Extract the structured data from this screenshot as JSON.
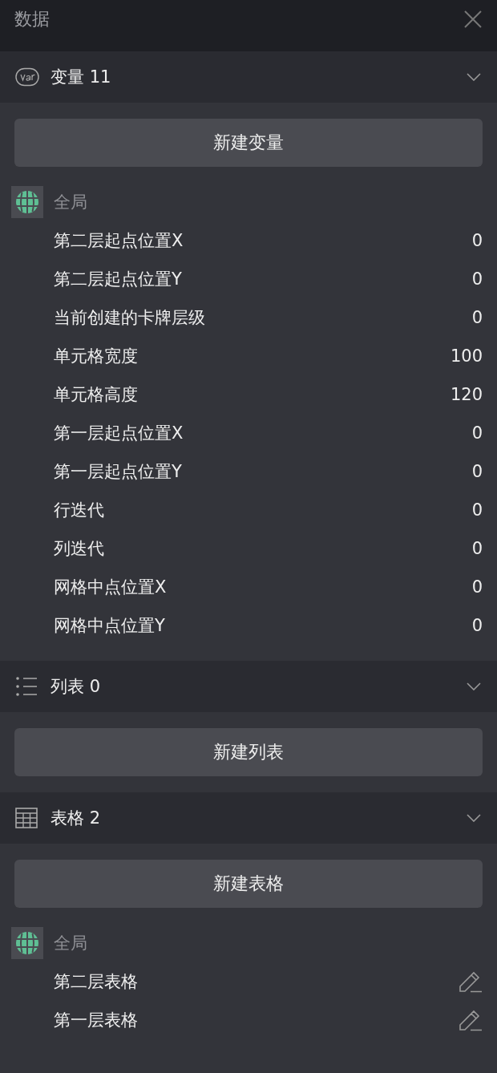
{
  "panel": {
    "title": "数据"
  },
  "sections": [
    {
      "kind": "variables",
      "title": "变量 11",
      "button": "新建变量",
      "groups": [
        {
          "label": "全局",
          "items": [
            {
              "kind": "value",
              "name": "第二层起点位置X",
              "value": "0"
            },
            {
              "kind": "value",
              "name": "第二层起点位置Y",
              "value": "0"
            },
            {
              "kind": "value",
              "name": "当前创建的卡牌层级",
              "value": "0"
            },
            {
              "kind": "value",
              "name": "单元格宽度",
              "value": "100"
            },
            {
              "kind": "value",
              "name": "单元格高度",
              "value": "120"
            },
            {
              "kind": "value",
              "name": "第一层起点位置X",
              "value": "0"
            },
            {
              "kind": "value",
              "name": "第一层起点位置Y",
              "value": "0"
            },
            {
              "kind": "value",
              "name": "行迭代",
              "value": "0"
            },
            {
              "kind": "value",
              "name": "列迭代",
              "value": "0"
            },
            {
              "kind": "value",
              "name": "网格中点位置X",
              "value": "0"
            },
            {
              "kind": "value",
              "name": "网格中点位置Y",
              "value": "0"
            }
          ]
        }
      ]
    },
    {
      "kind": "lists",
      "title": "列表 0",
      "button": "新建列表"
    },
    {
      "kind": "tables",
      "title": "表格 2",
      "button": "新建表格",
      "groups": [
        {
          "label": "全局",
          "items": [
            {
              "kind": "editable",
              "name": "第二层表格"
            },
            {
              "kind": "editable",
              "name": "第一层表格"
            }
          ]
        }
      ]
    }
  ]
}
